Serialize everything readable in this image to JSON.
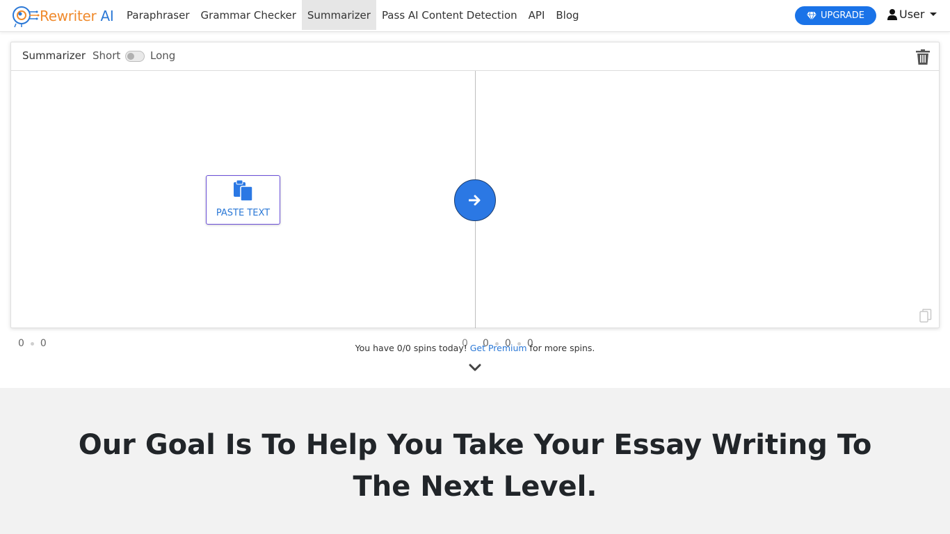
{
  "brand": {
    "name_part1": "Rewriter",
    "name_part2": " AI",
    "logo_icon": "brain-circuit-icon"
  },
  "nav": {
    "items": [
      {
        "label": "Paraphraser",
        "active": false
      },
      {
        "label": "Grammar Checker",
        "active": false
      },
      {
        "label": "Summarizer",
        "active": true
      },
      {
        "label": "Pass AI Content Detection",
        "active": false
      },
      {
        "label": "API",
        "active": false
      },
      {
        "label": "Blog",
        "active": false
      }
    ],
    "upgrade_label": "UPGRADE",
    "upgrade_icon": "diamond-icon",
    "user_label": "User",
    "user_icon": "user-icon"
  },
  "editor": {
    "title": "Summarizer",
    "mode_short": "Short",
    "mode_long": "Long",
    "toggle_on": false,
    "paste_label": "PASTE TEXT",
    "input_stats": {
      "words": "0",
      "chars": "0",
      "count": "0"
    },
    "output_stats": {
      "a": "0",
      "b": "0",
      "c": "0"
    }
  },
  "spins": {
    "prefix": "You have 0/0 spins today! ",
    "link": "Get Premium",
    "suffix": " for more spins."
  },
  "goal": {
    "title": "Our Goal Is To Help You Take Your Essay Writing To The Next Level."
  },
  "colors": {
    "accent": "#2b78e4",
    "brand_orange": "#f08a2c",
    "brand_blue": "#2b78d6"
  }
}
